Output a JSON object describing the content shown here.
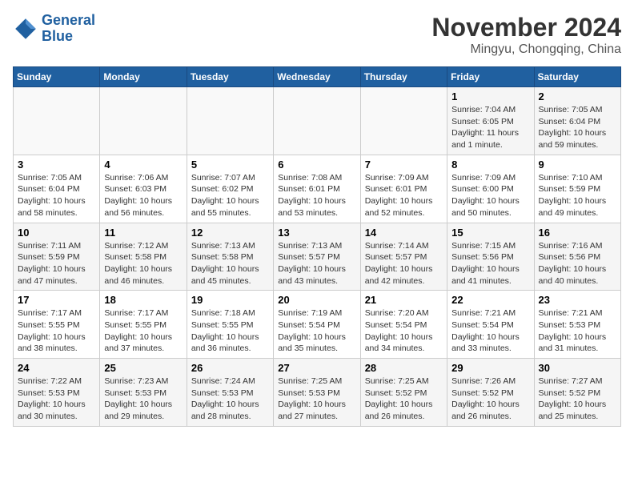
{
  "header": {
    "logo_line1": "General",
    "logo_line2": "Blue",
    "month": "November 2024",
    "location": "Mingyu, Chongqing, China"
  },
  "weekdays": [
    "Sunday",
    "Monday",
    "Tuesday",
    "Wednesday",
    "Thursday",
    "Friday",
    "Saturday"
  ],
  "weeks": [
    [
      {
        "day": "",
        "info": ""
      },
      {
        "day": "",
        "info": ""
      },
      {
        "day": "",
        "info": ""
      },
      {
        "day": "",
        "info": ""
      },
      {
        "day": "",
        "info": ""
      },
      {
        "day": "1",
        "info": "Sunrise: 7:04 AM\nSunset: 6:05 PM\nDaylight: 11 hours\nand 1 minute."
      },
      {
        "day": "2",
        "info": "Sunrise: 7:05 AM\nSunset: 6:04 PM\nDaylight: 10 hours\nand 59 minutes."
      }
    ],
    [
      {
        "day": "3",
        "info": "Sunrise: 7:05 AM\nSunset: 6:04 PM\nDaylight: 10 hours\nand 58 minutes."
      },
      {
        "day": "4",
        "info": "Sunrise: 7:06 AM\nSunset: 6:03 PM\nDaylight: 10 hours\nand 56 minutes."
      },
      {
        "day": "5",
        "info": "Sunrise: 7:07 AM\nSunset: 6:02 PM\nDaylight: 10 hours\nand 55 minutes."
      },
      {
        "day": "6",
        "info": "Sunrise: 7:08 AM\nSunset: 6:01 PM\nDaylight: 10 hours\nand 53 minutes."
      },
      {
        "day": "7",
        "info": "Sunrise: 7:09 AM\nSunset: 6:01 PM\nDaylight: 10 hours\nand 52 minutes."
      },
      {
        "day": "8",
        "info": "Sunrise: 7:09 AM\nSunset: 6:00 PM\nDaylight: 10 hours\nand 50 minutes."
      },
      {
        "day": "9",
        "info": "Sunrise: 7:10 AM\nSunset: 5:59 PM\nDaylight: 10 hours\nand 49 minutes."
      }
    ],
    [
      {
        "day": "10",
        "info": "Sunrise: 7:11 AM\nSunset: 5:59 PM\nDaylight: 10 hours\nand 47 minutes."
      },
      {
        "day": "11",
        "info": "Sunrise: 7:12 AM\nSunset: 5:58 PM\nDaylight: 10 hours\nand 46 minutes."
      },
      {
        "day": "12",
        "info": "Sunrise: 7:13 AM\nSunset: 5:58 PM\nDaylight: 10 hours\nand 45 minutes."
      },
      {
        "day": "13",
        "info": "Sunrise: 7:13 AM\nSunset: 5:57 PM\nDaylight: 10 hours\nand 43 minutes."
      },
      {
        "day": "14",
        "info": "Sunrise: 7:14 AM\nSunset: 5:57 PM\nDaylight: 10 hours\nand 42 minutes."
      },
      {
        "day": "15",
        "info": "Sunrise: 7:15 AM\nSunset: 5:56 PM\nDaylight: 10 hours\nand 41 minutes."
      },
      {
        "day": "16",
        "info": "Sunrise: 7:16 AM\nSunset: 5:56 PM\nDaylight: 10 hours\nand 40 minutes."
      }
    ],
    [
      {
        "day": "17",
        "info": "Sunrise: 7:17 AM\nSunset: 5:55 PM\nDaylight: 10 hours\nand 38 minutes."
      },
      {
        "day": "18",
        "info": "Sunrise: 7:17 AM\nSunset: 5:55 PM\nDaylight: 10 hours\nand 37 minutes."
      },
      {
        "day": "19",
        "info": "Sunrise: 7:18 AM\nSunset: 5:55 PM\nDaylight: 10 hours\nand 36 minutes."
      },
      {
        "day": "20",
        "info": "Sunrise: 7:19 AM\nSunset: 5:54 PM\nDaylight: 10 hours\nand 35 minutes."
      },
      {
        "day": "21",
        "info": "Sunrise: 7:20 AM\nSunset: 5:54 PM\nDaylight: 10 hours\nand 34 minutes."
      },
      {
        "day": "22",
        "info": "Sunrise: 7:21 AM\nSunset: 5:54 PM\nDaylight: 10 hours\nand 33 minutes."
      },
      {
        "day": "23",
        "info": "Sunrise: 7:21 AM\nSunset: 5:53 PM\nDaylight: 10 hours\nand 31 minutes."
      }
    ],
    [
      {
        "day": "24",
        "info": "Sunrise: 7:22 AM\nSunset: 5:53 PM\nDaylight: 10 hours\nand 30 minutes."
      },
      {
        "day": "25",
        "info": "Sunrise: 7:23 AM\nSunset: 5:53 PM\nDaylight: 10 hours\nand 29 minutes."
      },
      {
        "day": "26",
        "info": "Sunrise: 7:24 AM\nSunset: 5:53 PM\nDaylight: 10 hours\nand 28 minutes."
      },
      {
        "day": "27",
        "info": "Sunrise: 7:25 AM\nSunset: 5:53 PM\nDaylight: 10 hours\nand 27 minutes."
      },
      {
        "day": "28",
        "info": "Sunrise: 7:25 AM\nSunset: 5:52 PM\nDaylight: 10 hours\nand 26 minutes."
      },
      {
        "day": "29",
        "info": "Sunrise: 7:26 AM\nSunset: 5:52 PM\nDaylight: 10 hours\nand 26 minutes."
      },
      {
        "day": "30",
        "info": "Sunrise: 7:27 AM\nSunset: 5:52 PM\nDaylight: 10 hours\nand 25 minutes."
      }
    ]
  ]
}
